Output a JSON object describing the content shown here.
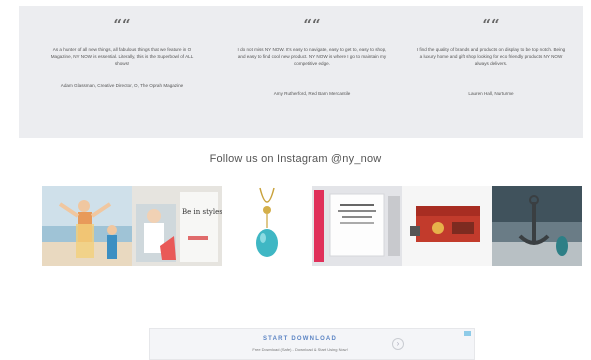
{
  "testimonials": [
    {
      "quote_mark": "““",
      "text": "As a hunter of all new things, all fabulous things that we feature in O Magazine, NY NOW is essential. Literally, this is the Superbowl of ALL shows!",
      "author": "Adam Glassman, Creative Director, O, The Oprah Magazine"
    },
    {
      "quote_mark": "““",
      "text": "I do not miss NY NOW. It's easy to navigate, easy to get to, easy to shop, and easy to find cool new product. NY NOW is where I go to maintain my competitive edge.",
      "author": "Amy Rutherford, Red Barn Mercantile"
    },
    {
      "quote_mark": "““",
      "text": "I find the quality of brands and products on display to be top notch. Being a luxury home and gift shop looking for eco friendly products NY NOW always delivers.",
      "author": "Lauren Hall, Nurturme"
    }
  ],
  "instagram": {
    "title": "Follow us on Instagram @ny_now",
    "photos": [
      {
        "icon": "beach-kids-photo"
      },
      {
        "icon": "be-in-style-card-photo",
        "caption": "Be in styles"
      },
      {
        "icon": "turquoise-pendant-photo"
      },
      {
        "icon": "greeting-card-photo"
      },
      {
        "icon": "red-boxes-photo"
      },
      {
        "icon": "anchor-decor-photo"
      }
    ]
  },
  "ad": {
    "title": "START DOWNLOAD",
    "subtitle": "Free Download (Safe) - Download & Start Using Now!",
    "arrow": "›"
  }
}
